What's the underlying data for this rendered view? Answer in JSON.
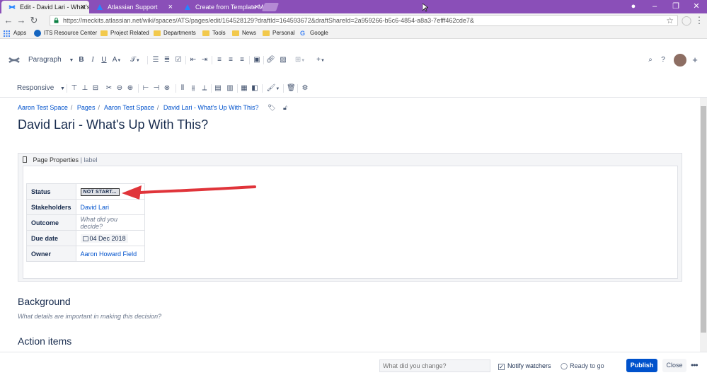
{
  "browser": {
    "tabs": [
      {
        "label": "Edit - David Lari - What's",
        "active": true
      },
      {
        "label": "Atlassian Support",
        "active": false
      },
      {
        "label": "Create from Template Ma",
        "active": false
      }
    ],
    "url": "https://meckits.atlassian.net/wiki/spaces/ATS/pages/edit/164528129?draftId=164593672&draftShareId=2a959266-b5c6-4854-a8a3-7efff462cde7&",
    "bookmarks": [
      "Apps",
      "ITS Resource Center",
      "Project Related",
      "Departments",
      "Tools",
      "News",
      "Personal",
      "Google"
    ]
  },
  "toolbar": {
    "paragraph_label": "Paragraph",
    "bold": "B",
    "italic": "I",
    "underline": "U",
    "text_color": "A",
    "responsive_label": "Responsive"
  },
  "page": {
    "breadcrumb": [
      "Aaron Test Space",
      "Pages",
      "Aaron Test Space",
      "David Lari - What's Up With This?"
    ],
    "title": "David Lari - What's Up With This?"
  },
  "macro": {
    "name": "Page Properties",
    "separator": "|",
    "label": "label",
    "rows": [
      {
        "key": "Status",
        "value": "NOT START..."
      },
      {
        "key": "Stakeholders",
        "value": "David Lari"
      },
      {
        "key": "Outcome",
        "value": "What did you decide?"
      },
      {
        "key": "Due date",
        "value": "04 Dec 2018"
      },
      {
        "key": "Owner",
        "value": "Aaron Howard Field"
      }
    ]
  },
  "sections": {
    "background_heading": "Background",
    "background_placeholder": "What details are important in making this decision?",
    "action_items_heading": "Action items"
  },
  "footer": {
    "changes_placeholder": "What did you change?",
    "notify_label": "Notify watchers",
    "notify_checked": true,
    "ready_label": "Ready to go",
    "publish_label": "Publish",
    "close_label": "Close"
  },
  "colors": {
    "tabbar": "#8a4fb8",
    "primary": "#0052cc",
    "annotation_arrow": "#e0343a"
  }
}
